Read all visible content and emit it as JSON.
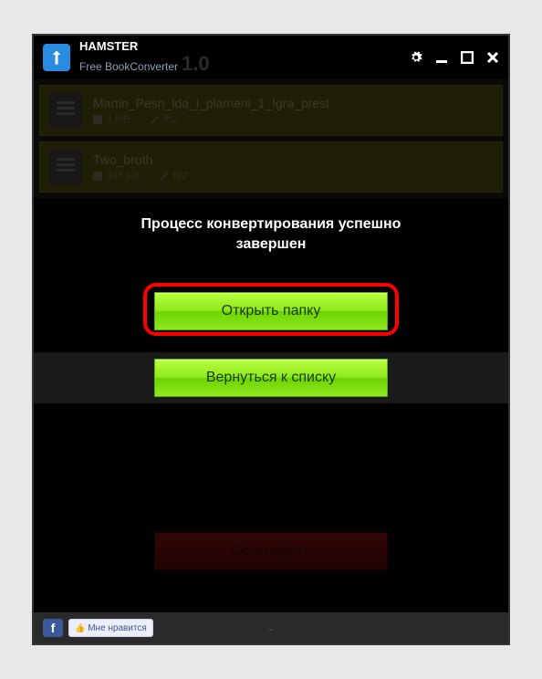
{
  "app": {
    "name": "HAMSTER",
    "subtitle": "Free BookConverter",
    "version": "1.0"
  },
  "files": [
    {
      "name": "Martin_Pesn_lda_i_plameni_1_Igra_prest",
      "size": "1 MB",
      "format": "fb2"
    },
    {
      "name": "Two_broth",
      "size": "945 KB",
      "format": "fb2"
    }
  ],
  "overlay": {
    "message": "Процесс конвертирования успешно завершен",
    "buttons": {
      "open_folder": "Открыть папку",
      "back_to_list": "Вернуться к списку",
      "stop": "Остановить"
    }
  },
  "footer": {
    "fb": "f",
    "like": "Мне нравится"
  }
}
